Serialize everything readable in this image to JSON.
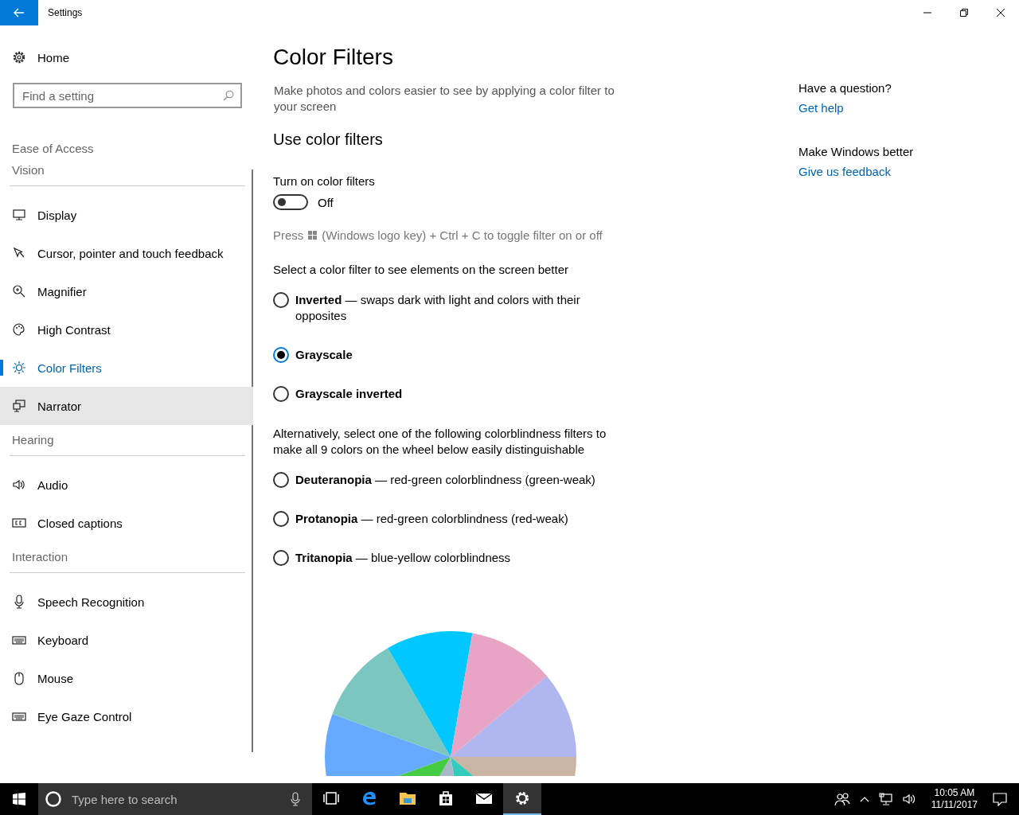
{
  "window": {
    "title": "Settings"
  },
  "sidebar": {
    "home": "Home",
    "search": {
      "placeholder": "Find a setting"
    },
    "section": "Ease of Access",
    "groups": [
      {
        "title": "Vision",
        "items": [
          {
            "label": "Display",
            "selected": false,
            "hovered": false
          },
          {
            "label": "Cursor, pointer and touch feedback",
            "selected": false,
            "hovered": false
          },
          {
            "label": "Magnifier",
            "selected": false,
            "hovered": false
          },
          {
            "label": "High Contrast",
            "selected": false,
            "hovered": false
          },
          {
            "label": "Color Filters",
            "selected": true,
            "hovered": false
          },
          {
            "label": "Narrator",
            "selected": false,
            "hovered": true
          }
        ]
      },
      {
        "title": "Hearing",
        "items": [
          {
            "label": "Audio",
            "selected": false,
            "hovered": false
          },
          {
            "label": "Closed captions",
            "selected": false,
            "hovered": false
          }
        ]
      },
      {
        "title": "Interaction",
        "items": [
          {
            "label": "Speech Recognition",
            "selected": false,
            "hovered": false
          },
          {
            "label": "Keyboard",
            "selected": false,
            "hovered": false
          },
          {
            "label": "Mouse",
            "selected": false,
            "hovered": false
          },
          {
            "label": "Eye Gaze Control",
            "selected": false,
            "hovered": false
          }
        ]
      }
    ]
  },
  "content": {
    "title": "Color Filters",
    "description": "Make photos and colors easier to see by applying a color filter to your screen",
    "section": "Use color filters",
    "toggle": {
      "label": "Turn on color filters",
      "on": false,
      "state": "Off"
    },
    "hint": {
      "before": "Press",
      "after": "(Windows logo key) + Ctrl + C to toggle filter on or off"
    },
    "filters_label": "Select a color filter to see elements on the screen better",
    "filters": [
      {
        "name": "Inverted",
        "description": "— swaps dark with light and colors with their opposites",
        "selected": false
      },
      {
        "name": "Grayscale",
        "selected": true
      },
      {
        "name": "Grayscale inverted",
        "selected": false
      }
    ],
    "colorblind_label": "Alternatively, select one of the following colorblindness filters to make all 9 colors on the wheel below easily distinguishable",
    "colorblind_filters": [
      {
        "name": "Deuteranopia",
        "description": "— red-green colorblindness (green-weak)",
        "selected": false
      },
      {
        "name": "Protanopia",
        "description": "— red-green colorblindness (red-weak)",
        "selected": false
      },
      {
        "name": "Tritanopia",
        "description": "— blue-yellow colorblindness",
        "selected": false
      }
    ]
  },
  "aside": [
    {
      "heading": "Have a question?",
      "link": "Get help"
    },
    {
      "heading": "Make Windows better",
      "link": "Give us feedback"
    }
  ],
  "taskbar": {
    "search": {
      "placeholder": "Type here to search"
    },
    "apps": [
      {
        "kind": "taskview",
        "selected": false
      },
      {
        "kind": "edge",
        "selected": false
      },
      {
        "kind": "folder",
        "selected": false
      },
      {
        "kind": "store",
        "selected": false
      },
      {
        "kind": "mail",
        "selected": false
      },
      {
        "kind": "settings",
        "selected": true
      }
    ],
    "time": "10:05 AM",
    "date": "11/11/2017"
  }
}
